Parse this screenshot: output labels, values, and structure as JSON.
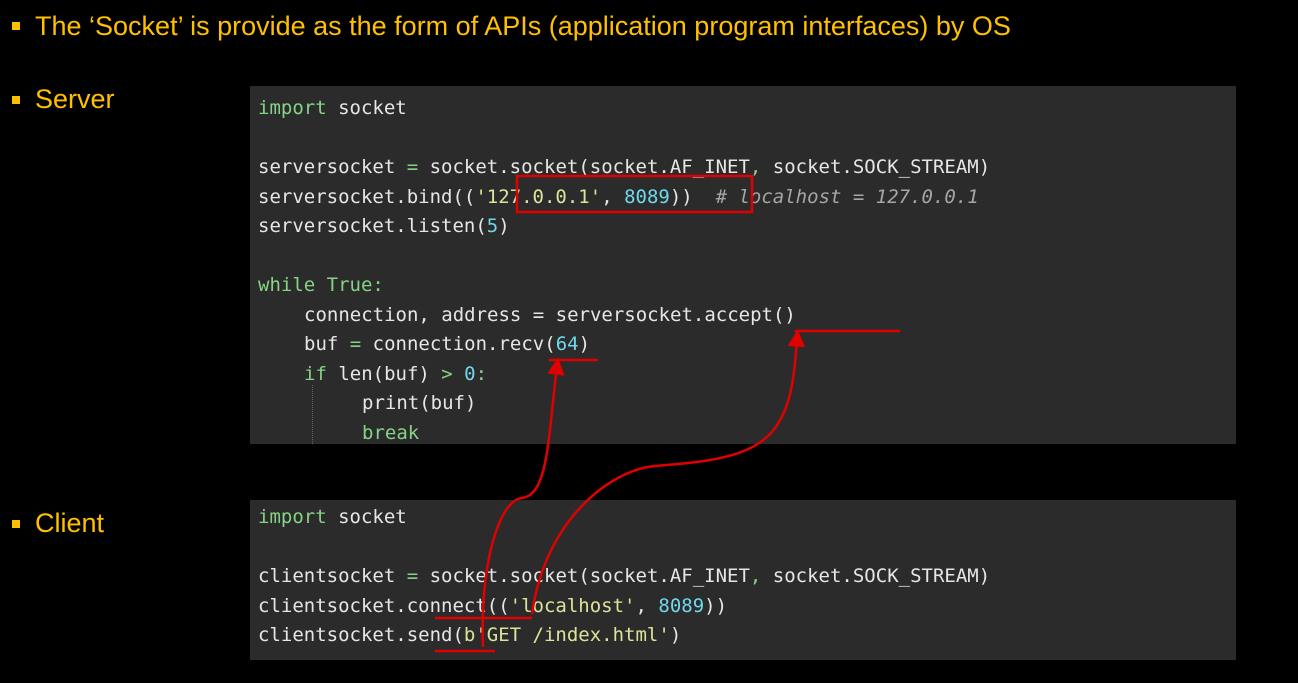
{
  "heading": "The ‘Socket’ is provide as the form of APIs (application program interfaces) by OS",
  "labels": {
    "server": "Server",
    "client": "Client"
  },
  "server_code": {
    "import_kw": "import",
    "import_mod": " socket",
    "l2_a": "serversocket ",
    "l2_op": "=",
    "l2_b": " socket.socket(socket.AF_INET",
    "l2_c": ",",
    "l2_d": " socket.SOCK_STREAM)",
    "l3_a": "serversocket.bind((",
    "l3_str": "'127.0.0.1'",
    "l3_sep": ", ",
    "l3_num": "8089",
    "l3_close": "))",
    "l3_cmt": "  # localhost = 127.0.0.1",
    "l4_a": "serversocket.listen(",
    "l4_num": "5",
    "l4_close": ")",
    "l6_kw": "while",
    "l6_b": " True",
    "l6_c": ":",
    "l7": "connection, address = serversocket.accept()",
    "l8_a": "buf ",
    "l8_op": "=",
    "l8_b": " connection.recv(",
    "l8_num": "64",
    "l8_close": ")",
    "l9_kw": "if",
    "l9_b": " len(buf) ",
    "l9_op": ">",
    "l9_num": " 0",
    "l9_c": ":",
    "l10": "print(buf)",
    "l11": "break"
  },
  "client_code": {
    "import_kw": "import",
    "import_mod": " socket",
    "l2_a": "clientsocket ",
    "l2_op": "=",
    "l2_b": " socket.socket(socket.AF_INET",
    "l2_c": ",",
    "l2_d": " socket.SOCK_STREAM)",
    "l3_a": "clientsocket.connect((",
    "l3_str": "'localhost'",
    "l3_sep": ", ",
    "l3_num": "8089",
    "l3_close": "))",
    "l4_a": "clientsocket.send(",
    "l4_str": "b'GET /index.html'",
    "l4_close": ")"
  },
  "colors": {
    "accent": "#ffc000",
    "annotation": "#e00000",
    "panel_bg": "#2b2b2b",
    "keyword": "#86d385",
    "string": "#dfe39a",
    "number": "#6fd8ec",
    "comment": "#a6a6a6"
  }
}
